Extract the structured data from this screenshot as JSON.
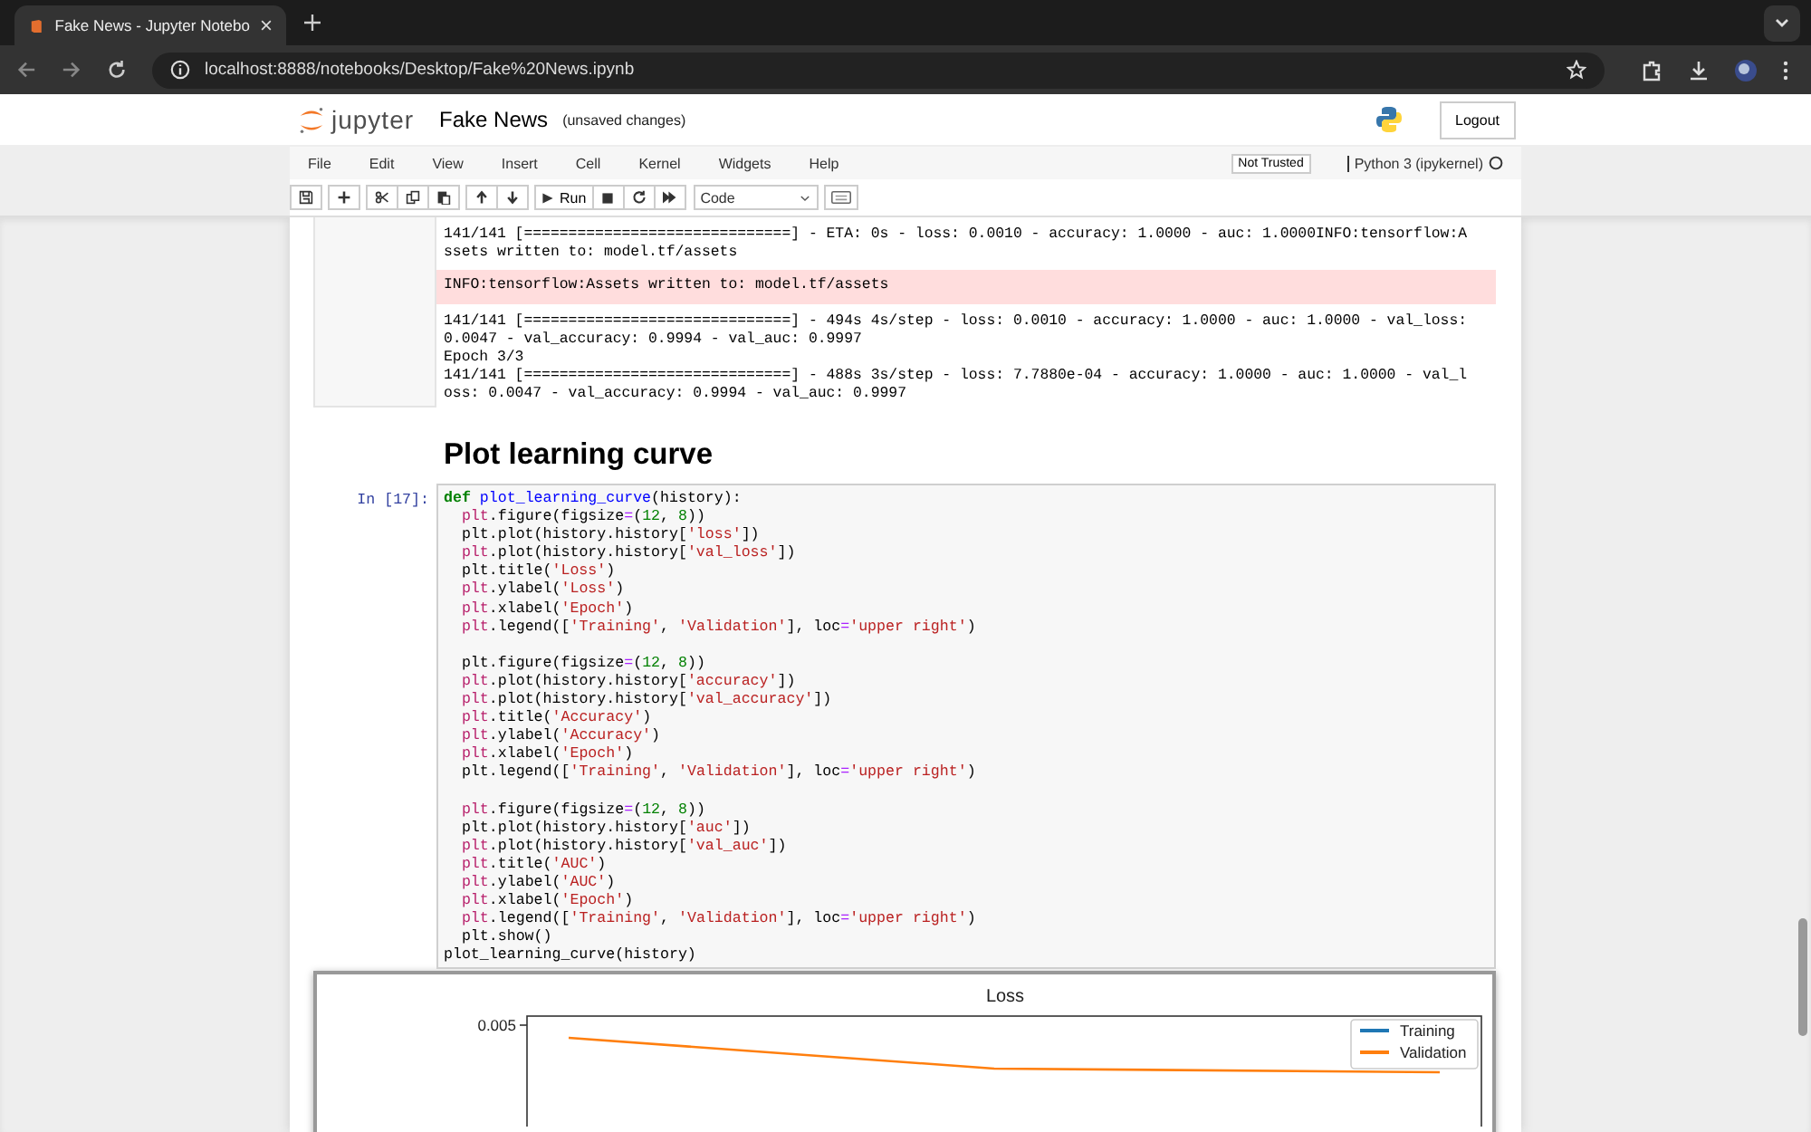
{
  "browser": {
    "tab_title": "Fake News - Jupyter Notebo",
    "url": "localhost:8888/notebooks/Desktop/Fake%20News.ipynb"
  },
  "header": {
    "logo_text": "jupyter",
    "notebook_name": "Fake News",
    "save_status": "(unsaved changes)",
    "logout": "Logout"
  },
  "menu": [
    "File",
    "Edit",
    "View",
    "Insert",
    "Cell",
    "Kernel",
    "Widgets",
    "Help"
  ],
  "trust": "Not Trusted",
  "kernel": {
    "name": "Python 3 (ipykernel)",
    "busy": false
  },
  "toolbar": {
    "run": "Run",
    "cell_type": "Code"
  },
  "output": {
    "lines": [
      {
        "kind": "stdout",
        "text": "141/141 [==============================] - ETA: 0s - loss: 0.0010 - accuracy: 1.0000 - auc: 1.0000INFO:tensorflow:A"
      },
      {
        "kind": "stdout",
        "text": "ssets written to: model.tf/assets"
      },
      {
        "kind": "stderr",
        "text": "INFO:tensorflow:Assets written to: model.tf/assets"
      },
      {
        "kind": "stdout",
        "text": "141/141 [==============================] - 494s 4s/step - loss: 0.0010 - accuracy: 1.0000 - auc: 1.0000 - val_loss:"
      },
      {
        "kind": "stdout",
        "text": "0.0047 - val_accuracy: 0.9994 - val_auc: 0.9997"
      },
      {
        "kind": "stdout",
        "text": "Epoch 3/3"
      },
      {
        "kind": "stdout",
        "text": "141/141 [==============================] - 488s 3s/step - loss: 7.7880e-04 - accuracy: 1.0000 - auc: 1.0000 - val_l"
      },
      {
        "kind": "stdout",
        "text": "oss: 0.0047 - val_accuracy: 0.9994 - val_auc: 0.9997"
      }
    ]
  },
  "heading": "Plot learning curve",
  "code_cell": {
    "prompt": "In [17]:",
    "lines": [
      {
        "kind": "code",
        "tokens": [
          {
            "kind": "k",
            "text": "def "
          },
          {
            "kind": "f",
            "text": "plot_learning_curve"
          },
          {
            "kind": "p",
            "text": "(history):"
          }
        ]
      },
      {
        "kind": "code",
        "tokens": [
          {
            "kind": "v",
            "text": "  plt"
          },
          {
            "kind": "p",
            "text": ".figure(figsize"
          },
          {
            "kind": "o",
            "text": "="
          },
          {
            "kind": "p",
            "text": "("
          },
          {
            "kind": "n",
            "text": "12"
          },
          {
            "kind": "p",
            "text": ", "
          },
          {
            "kind": "n",
            "text": "8"
          },
          {
            "kind": "p",
            "text": "))"
          }
        ]
      },
      {
        "kind": "code",
        "tokens": [
          {
            "kind": "p",
            "text": "  plt.plot(history.history["
          },
          {
            "kind": "s",
            "text": "'loss'"
          },
          {
            "kind": "p",
            "text": "])"
          }
        ]
      },
      {
        "kind": "code",
        "tokens": [
          {
            "kind": "v",
            "text": "  plt"
          },
          {
            "kind": "p",
            "text": ".plot(history.history["
          },
          {
            "kind": "s",
            "text": "'val_loss'"
          },
          {
            "kind": "p",
            "text": "])"
          }
        ]
      },
      {
        "kind": "code",
        "tokens": [
          {
            "kind": "p",
            "text": "  plt.title("
          },
          {
            "kind": "s",
            "text": "'Loss'"
          },
          {
            "kind": "p",
            "text": ")"
          }
        ]
      },
      {
        "kind": "code",
        "tokens": [
          {
            "kind": "v",
            "text": "  plt"
          },
          {
            "kind": "p",
            "text": ".ylabel("
          },
          {
            "kind": "s",
            "text": "'Loss'"
          },
          {
            "kind": "p",
            "text": ")"
          }
        ]
      },
      {
        "kind": "code",
        "tokens": [
          {
            "kind": "v",
            "text": "  plt"
          },
          {
            "kind": "p",
            "text": ".xlabel("
          },
          {
            "kind": "s",
            "text": "'Epoch'"
          },
          {
            "kind": "p",
            "text": ")"
          }
        ]
      },
      {
        "kind": "code",
        "tokens": [
          {
            "kind": "v",
            "text": "  plt"
          },
          {
            "kind": "p",
            "text": ".legend(["
          },
          {
            "kind": "s",
            "text": "'Training'"
          },
          {
            "kind": "p",
            "text": ", "
          },
          {
            "kind": "s",
            "text": "'Validation'"
          },
          {
            "kind": "p",
            "text": "], loc"
          },
          {
            "kind": "o",
            "text": "="
          },
          {
            "kind": "s",
            "text": "'upper right'"
          },
          {
            "kind": "p",
            "text": ")"
          }
        ]
      },
      {
        "kind": "blank"
      },
      {
        "kind": "code",
        "tokens": [
          {
            "kind": "p",
            "text": "  plt.figure(figsize"
          },
          {
            "kind": "o",
            "text": "="
          },
          {
            "kind": "p",
            "text": "("
          },
          {
            "kind": "n",
            "text": "12"
          },
          {
            "kind": "p",
            "text": ", "
          },
          {
            "kind": "n",
            "text": "8"
          },
          {
            "kind": "p",
            "text": "))"
          }
        ]
      },
      {
        "kind": "code",
        "tokens": [
          {
            "kind": "v",
            "text": "  plt"
          },
          {
            "kind": "p",
            "text": ".plot(history.history["
          },
          {
            "kind": "s",
            "text": "'accuracy'"
          },
          {
            "kind": "p",
            "text": "])"
          }
        ]
      },
      {
        "kind": "code",
        "tokens": [
          {
            "kind": "v",
            "text": "  plt"
          },
          {
            "kind": "p",
            "text": ".plot(history.history["
          },
          {
            "kind": "s",
            "text": "'val_accuracy'"
          },
          {
            "kind": "p",
            "text": "])"
          }
        ]
      },
      {
        "kind": "code",
        "tokens": [
          {
            "kind": "v",
            "text": "  plt"
          },
          {
            "kind": "p",
            "text": ".title("
          },
          {
            "kind": "s",
            "text": "'Accuracy'"
          },
          {
            "kind": "p",
            "text": ")"
          }
        ]
      },
      {
        "kind": "code",
        "tokens": [
          {
            "kind": "v",
            "text": "  plt"
          },
          {
            "kind": "p",
            "text": ".ylabel("
          },
          {
            "kind": "s",
            "text": "'Accuracy'"
          },
          {
            "kind": "p",
            "text": ")"
          }
        ]
      },
      {
        "kind": "code",
        "tokens": [
          {
            "kind": "v",
            "text": "  plt"
          },
          {
            "kind": "p",
            "text": ".xlabel("
          },
          {
            "kind": "s",
            "text": "'Epoch'"
          },
          {
            "kind": "p",
            "text": ")"
          }
        ]
      },
      {
        "kind": "code",
        "tokens": [
          {
            "kind": "p",
            "text": "  plt.legend(["
          },
          {
            "kind": "s",
            "text": "'Training'"
          },
          {
            "kind": "p",
            "text": ", "
          },
          {
            "kind": "s",
            "text": "'Validation'"
          },
          {
            "kind": "p",
            "text": "], loc"
          },
          {
            "kind": "o",
            "text": "="
          },
          {
            "kind": "s",
            "text": "'upper right'"
          },
          {
            "kind": "p",
            "text": ")"
          }
        ]
      },
      {
        "kind": "blank"
      },
      {
        "kind": "code",
        "tokens": [
          {
            "kind": "v",
            "text": "  plt"
          },
          {
            "kind": "p",
            "text": ".figure(figsize"
          },
          {
            "kind": "o",
            "text": "="
          },
          {
            "kind": "p",
            "text": "("
          },
          {
            "kind": "n",
            "text": "12"
          },
          {
            "kind": "p",
            "text": ", "
          },
          {
            "kind": "n",
            "text": "8"
          },
          {
            "kind": "p",
            "text": "))"
          }
        ]
      },
      {
        "kind": "code",
        "tokens": [
          {
            "kind": "p",
            "text": "  plt.plot(history.history["
          },
          {
            "kind": "s",
            "text": "'auc'"
          },
          {
            "kind": "p",
            "text": "])"
          }
        ]
      },
      {
        "kind": "code",
        "tokens": [
          {
            "kind": "v",
            "text": "  plt"
          },
          {
            "kind": "p",
            "text": ".plot(history.history["
          },
          {
            "kind": "s",
            "text": "'val_auc'"
          },
          {
            "kind": "p",
            "text": "])"
          }
        ]
      },
      {
        "kind": "code",
        "tokens": [
          {
            "kind": "v",
            "text": "  plt"
          },
          {
            "kind": "p",
            "text": ".title("
          },
          {
            "kind": "s",
            "text": "'AUC'"
          },
          {
            "kind": "p",
            "text": ")"
          }
        ]
      },
      {
        "kind": "code",
        "tokens": [
          {
            "kind": "v",
            "text": "  plt"
          },
          {
            "kind": "p",
            "text": ".ylabel("
          },
          {
            "kind": "s",
            "text": "'AUC'"
          },
          {
            "kind": "p",
            "text": ")"
          }
        ]
      },
      {
        "kind": "code",
        "tokens": [
          {
            "kind": "v",
            "text": "  plt"
          },
          {
            "kind": "p",
            "text": ".xlabel("
          },
          {
            "kind": "s",
            "text": "'Epoch'"
          },
          {
            "kind": "p",
            "text": ")"
          }
        ]
      },
      {
        "kind": "code",
        "tokens": [
          {
            "kind": "v",
            "text": "  plt"
          },
          {
            "kind": "p",
            "text": ".legend(["
          },
          {
            "kind": "s",
            "text": "'Training'"
          },
          {
            "kind": "p",
            "text": ", "
          },
          {
            "kind": "s",
            "text": "'Validation'"
          },
          {
            "kind": "p",
            "text": "], loc"
          },
          {
            "kind": "o",
            "text": "="
          },
          {
            "kind": "s",
            "text": "'upper right'"
          },
          {
            "kind": "p",
            "text": ")"
          }
        ]
      },
      {
        "kind": "code",
        "tokens": [
          {
            "kind": "p",
            "text": "  plt.show()"
          }
        ]
      },
      {
        "kind": "code",
        "tokens": [
          {
            "kind": "p",
            "text": "plot_learning_curve(history)"
          }
        ]
      }
    ]
  },
  "figure": {
    "title": "Loss",
    "ytick": "0.005",
    "legend": [
      {
        "label": "Training",
        "color": "#1f77b4"
      },
      {
        "label": "Validation",
        "color": "#ff7f0e"
      }
    ]
  }
}
